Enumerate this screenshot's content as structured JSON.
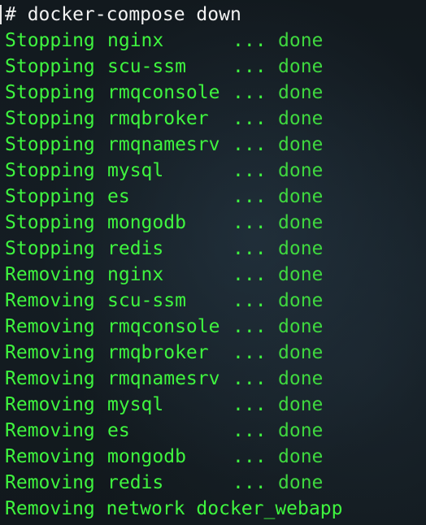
{
  "command": "# docker-compose down",
  "dots": "...",
  "rows": [
    {
      "action": "Stopping",
      "name": "nginx",
      "status": "done"
    },
    {
      "action": "Stopping",
      "name": "scu-ssm",
      "status": "done"
    },
    {
      "action": "Stopping",
      "name": "rmqconsole",
      "status": "done"
    },
    {
      "action": "Stopping",
      "name": "rmqbroker",
      "status": "done"
    },
    {
      "action": "Stopping",
      "name": "rmqnamesrv",
      "status": "done"
    },
    {
      "action": "Stopping",
      "name": "mysql",
      "status": "done"
    },
    {
      "action": "Stopping",
      "name": "es",
      "status": "done"
    },
    {
      "action": "Stopping",
      "name": "mongodb",
      "status": "done"
    },
    {
      "action": "Stopping",
      "name": "redis",
      "status": "done"
    },
    {
      "action": "Removing",
      "name": "nginx",
      "status": "done"
    },
    {
      "action": "Removing",
      "name": "scu-ssm",
      "status": "done"
    },
    {
      "action": "Removing",
      "name": "rmqconsole",
      "status": "done"
    },
    {
      "action": "Removing",
      "name": "rmqbroker",
      "status": "done"
    },
    {
      "action": "Removing",
      "name": "rmqnamesrv",
      "status": "done"
    },
    {
      "action": "Removing",
      "name": "mysql",
      "status": "done"
    },
    {
      "action": "Removing",
      "name": "es",
      "status": "done"
    },
    {
      "action": "Removing",
      "name": "mongodb",
      "status": "done"
    },
    {
      "action": "Removing",
      "name": "redis",
      "status": "done"
    }
  ],
  "final_line": "Removing network docker_webapp",
  "colors": {
    "output_text": "#3ff53f",
    "prompt_text": "#f2f2f2",
    "background": "#0f1519"
  }
}
